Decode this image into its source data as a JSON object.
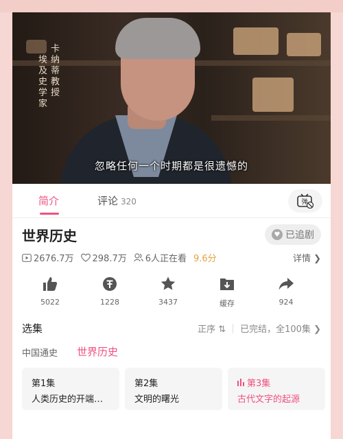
{
  "video": {
    "overlay_vertical_left": "埃及史学家",
    "overlay_vertical_right": "卡纳蒂教授",
    "subtitle": "忽略任何一个时期都是很遗憾的"
  },
  "tabs": {
    "intro_label": "简介",
    "comments_label": "评论",
    "comments_count": "320",
    "danmaku_icon": "danmaku-toggle-icon"
  },
  "show": {
    "title": "世界历史",
    "follow_label": "已追剧",
    "plays": "2676.7万",
    "likes": "298.7万",
    "watching": "6人正在看",
    "rating": "9.6分",
    "detail_label": "详情"
  },
  "actions": [
    {
      "icon": "thumbs-up-icon",
      "label": "5022"
    },
    {
      "icon": "coin-icon",
      "label": "1228"
    },
    {
      "icon": "star-icon",
      "label": "3437"
    },
    {
      "icon": "download-icon",
      "label": "缓存"
    },
    {
      "icon": "share-icon",
      "label": "924"
    }
  ],
  "episodes": {
    "section_title": "选集",
    "sort_label": "正序",
    "status_label": "已完结，全100集",
    "categories": [
      "中国通史",
      "世界历史"
    ],
    "list": [
      {
        "num": "第1集",
        "name": "人类历史的开端…"
      },
      {
        "num": "第2集",
        "name": "文明的曙光"
      },
      {
        "num": "第3集",
        "name": "古代文字的起源"
      }
    ]
  },
  "colors": {
    "accent": "#f0507f",
    "rating": "#e5a33a",
    "background": "#f6d7d3"
  }
}
